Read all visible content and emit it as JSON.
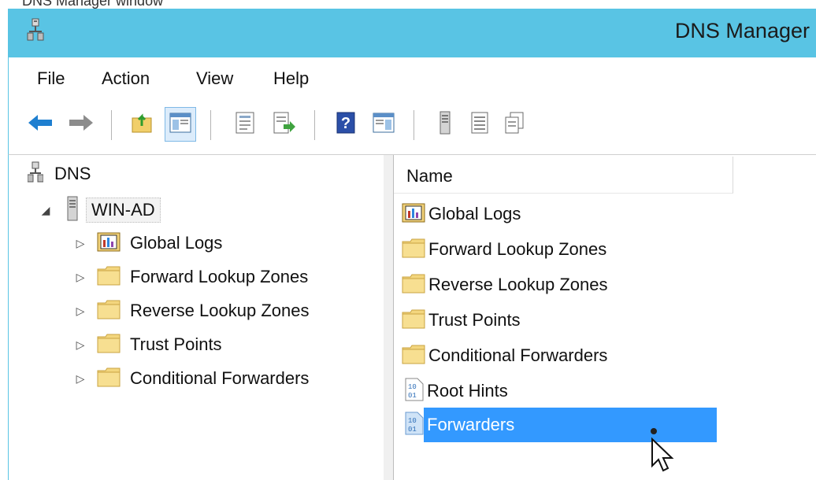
{
  "window": {
    "title": "DNS Manager",
    "colors": {
      "titlebar": "#59c4e4",
      "selection": "#3399ff"
    },
    "app_icon": "dns-server-icon"
  },
  "menu": [
    "File",
    "Action",
    "View",
    "Help"
  ],
  "toolbar": {
    "buttons": [
      {
        "icon": "back-arrow-icon"
      },
      {
        "icon": "forward-arrow-icon"
      },
      {
        "icon": "up-folder-icon"
      },
      {
        "icon": "show-hide-console-tree-icon",
        "pressed": true
      },
      {
        "icon": "properties-icon"
      },
      {
        "icon": "export-list-icon"
      },
      {
        "icon": "help-icon"
      },
      {
        "icon": "show-hide-action-pane-icon"
      },
      {
        "icon": "server-icon"
      },
      {
        "icon": "list-icon"
      },
      {
        "icon": "copy-icon"
      }
    ]
  },
  "tree": {
    "root": {
      "label": "DNS",
      "icon": "dns-icon"
    },
    "server": {
      "label": "WIN-AD",
      "icon": "server-icon",
      "expanded": true
    },
    "children": [
      {
        "label": "Global Logs",
        "icon": "event-log-icon"
      },
      {
        "label": "Forward Lookup Zones",
        "icon": "folder-icon"
      },
      {
        "label": "Reverse Lookup Zones",
        "icon": "folder-icon"
      },
      {
        "label": "Trust Points",
        "icon": "folder-icon"
      },
      {
        "label": "Conditional Forwarders",
        "icon": "folder-icon"
      }
    ]
  },
  "list": {
    "column": "Name",
    "items": [
      {
        "label": "Global Logs",
        "icon": "event-log-icon"
      },
      {
        "label": "Forward Lookup Zones",
        "icon": "folder-icon"
      },
      {
        "label": "Reverse Lookup Zones",
        "icon": "folder-icon"
      },
      {
        "label": "Trust Points",
        "icon": "folder-icon"
      },
      {
        "label": "Conditional Forwarders",
        "icon": "folder-icon"
      },
      {
        "label": "Root Hints",
        "icon": "binary-file-icon"
      },
      {
        "label": "Forwarders",
        "icon": "binary-file-icon",
        "selected": true
      }
    ]
  },
  "top_strip": {
    "text": "DNS Manager window"
  }
}
